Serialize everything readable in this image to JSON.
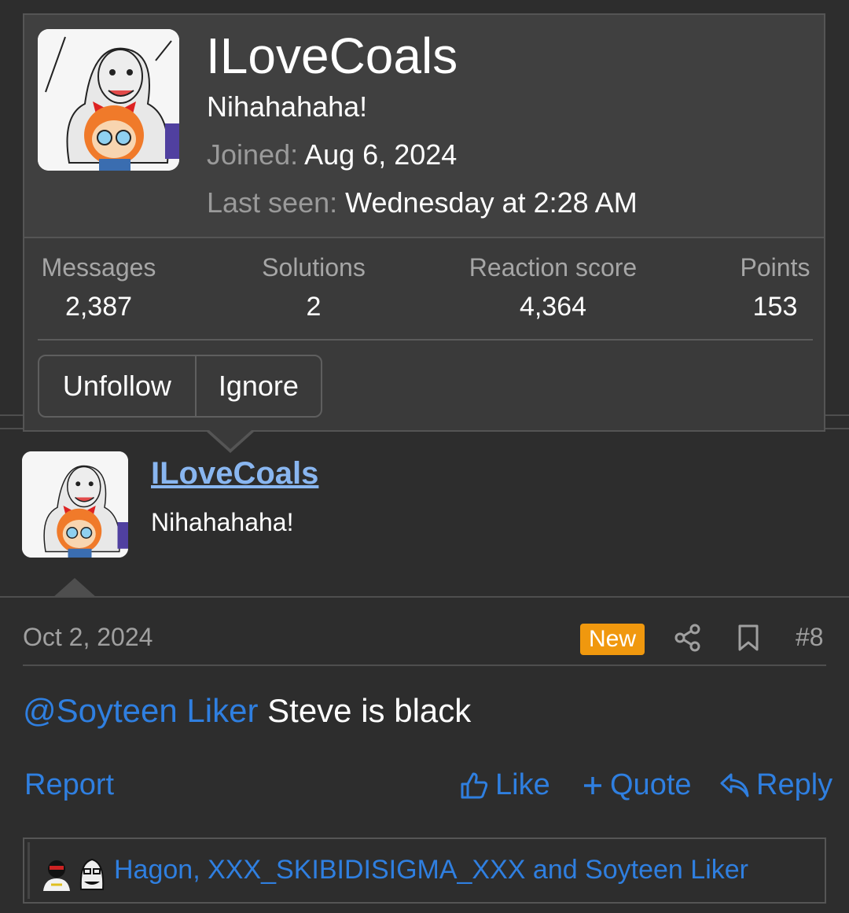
{
  "popup": {
    "username": "ILoveCoals",
    "user_title": "Nihahahaha!",
    "joined_label": "Joined:",
    "joined_value": "Aug 6, 2024",
    "last_seen_label": "Last seen:",
    "last_seen_value": "Wednesday at 2:28 AM",
    "stats": [
      {
        "label": "Messages",
        "value": "2,387"
      },
      {
        "label": "Solutions",
        "value": "2"
      },
      {
        "label": "Reaction score",
        "value": "4,364"
      },
      {
        "label": "Points",
        "value": "153"
      }
    ],
    "buttons": {
      "unfollow": "Unfollow",
      "ignore": "Ignore"
    }
  },
  "post": {
    "username": "ILoveCoals",
    "user_title": "Nihahahaha!",
    "date": "Oct 2, 2024",
    "new_badge": "New",
    "post_number": "#8",
    "mention": "@Soyteen Liker",
    "text": " Steve is black",
    "actions": {
      "report": "Report",
      "like": "Like",
      "quote": "Quote",
      "reply": "Reply"
    },
    "reactions_text": "Hagon, XXX_SKIBIDISIGMA_XXX and Soyteen Liker"
  },
  "colors": {
    "background": "#2d2d2d",
    "card": "#3a3a3a",
    "link": "#2f7fe0",
    "username_link": "#89b6f0",
    "badge": "#f0980e",
    "muted": "#a0a0a0"
  },
  "icons": [
    "share-icon",
    "bookmark-icon",
    "like-icon",
    "quote-icon",
    "reply-icon"
  ]
}
